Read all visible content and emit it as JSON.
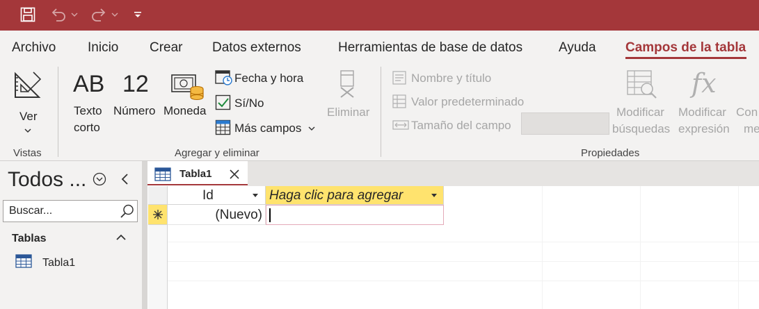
{
  "colors": {
    "accent": "#a4373a",
    "new_column_header": "#ffe36e"
  },
  "quick_access": {
    "save_icon": "save-icon",
    "undo_icon": "undo-icon",
    "redo_icon": "redo-icon",
    "customize_icon": "customize-qat-icon"
  },
  "tabs": {
    "archivo": "Archivo",
    "inicio": "Inicio",
    "crear": "Crear",
    "datos_externos": "Datos externos",
    "herramientas": "Herramientas de base de datos",
    "ayuda": "Ayuda",
    "campos": "Campos de la tabla",
    "active": "Campos de la tabla"
  },
  "ribbon": {
    "vistas": {
      "ver": "Ver",
      "group_label": "Vistas"
    },
    "agregar": {
      "texto_corto_big": "AB",
      "texto_corto_line1": "Texto",
      "texto_corto_line2": "corto",
      "numero_big": "12",
      "numero": "Número",
      "moneda": "Moneda",
      "fecha_hora": "Fecha y hora",
      "si_no": "Sí/No",
      "mas_campos": "Más campos",
      "eliminar": "Eliminar",
      "group_label": "Agregar y eliminar"
    },
    "propiedades": {
      "nombre_titulo": "Nombre y título",
      "valor_predeterminado": "Valor predeterminado",
      "tamano_campo": "Tamaño del campo",
      "modificar_busquedas_1": "Modificar",
      "modificar_busquedas_2": "búsquedas",
      "modificar_expresion_1": "Modificar",
      "modificar_expresion_2": "expresión",
      "con_1": "Con",
      "con_2": "me",
      "group_label": "Propiedades"
    }
  },
  "nav": {
    "title": "Todos ...",
    "search_placeholder": "Buscar...",
    "section": "Tablas",
    "items": [
      {
        "label": "Tabla1"
      }
    ]
  },
  "document": {
    "tab_label": "Tabla1",
    "columns": [
      {
        "label": "Id"
      },
      {
        "label": "Haga clic para agregar"
      }
    ],
    "new_row": {
      "id_value": "(Nuevo)",
      "new_field_value": ""
    }
  }
}
